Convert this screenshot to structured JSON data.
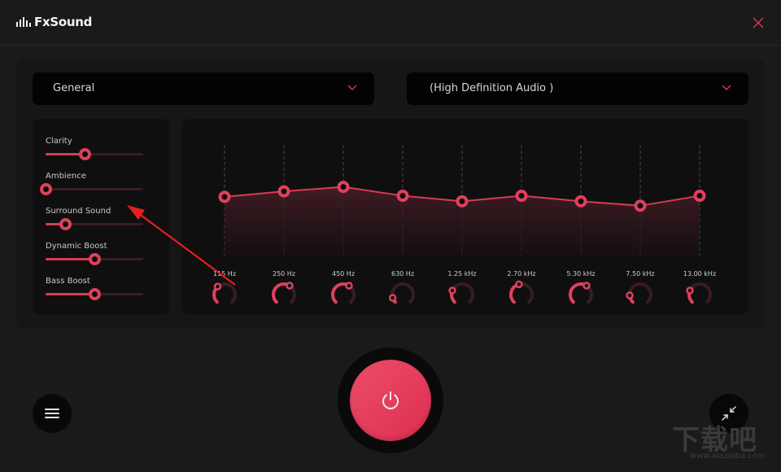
{
  "app": {
    "title": "FxSound",
    "logo_icon": "equalizer-bars-icon",
    "close_icon": "close-icon"
  },
  "colors": {
    "accent": "#e0405c",
    "accent_dark": "#3a1c24",
    "background": "#1a1a1a",
    "panel": "#0f0f0f",
    "dropdown": "#030303"
  },
  "preset_dropdown": {
    "selected": "General",
    "icon": "chevron-down-icon"
  },
  "device_dropdown": {
    "selected": "(High Definition Audio )",
    "icon": "chevron-down-icon"
  },
  "effects": [
    {
      "name": "Clarity",
      "value_pct": 40
    },
    {
      "name": "Ambience",
      "value_pct": 0
    },
    {
      "name": "Surround Sound",
      "value_pct": 20
    },
    {
      "name": "Dynamic Boost",
      "value_pct": 50
    },
    {
      "name": "Bass Boost",
      "value_pct": 50
    }
  ],
  "equalizer": {
    "bands": [
      {
        "freq": "115 Hz",
        "level": 0.53,
        "knob": 0.35
      },
      {
        "freq": "250 Hz",
        "level": 0.58,
        "knob": 0.62
      },
      {
        "freq": "450 Hz",
        "level": 0.62,
        "knob": 0.62
      },
      {
        "freq": "630 Hz",
        "level": 0.54,
        "knob": 0.1
      },
      {
        "freq": "1.25 kHz",
        "level": 0.49,
        "knob": 0.25
      },
      {
        "freq": "2.70 kHz",
        "level": 0.54,
        "knob": 0.45
      },
      {
        "freq": "5.30 kHz",
        "level": 0.49,
        "knob": 0.62
      },
      {
        "freq": "7.50 kHz",
        "level": 0.45,
        "knob": 0.15
      },
      {
        "freq": "13.00 kHz",
        "level": 0.54,
        "knob": 0.25
      }
    ]
  },
  "bottom_bar": {
    "menu_icon": "hamburger-menu-icon",
    "power_icon": "power-icon",
    "power_state": "on",
    "collapse_icon": "collapse-arrows-icon"
  },
  "watermark": {
    "text": "下载吧",
    "url": "www.xiazaiba.com"
  }
}
